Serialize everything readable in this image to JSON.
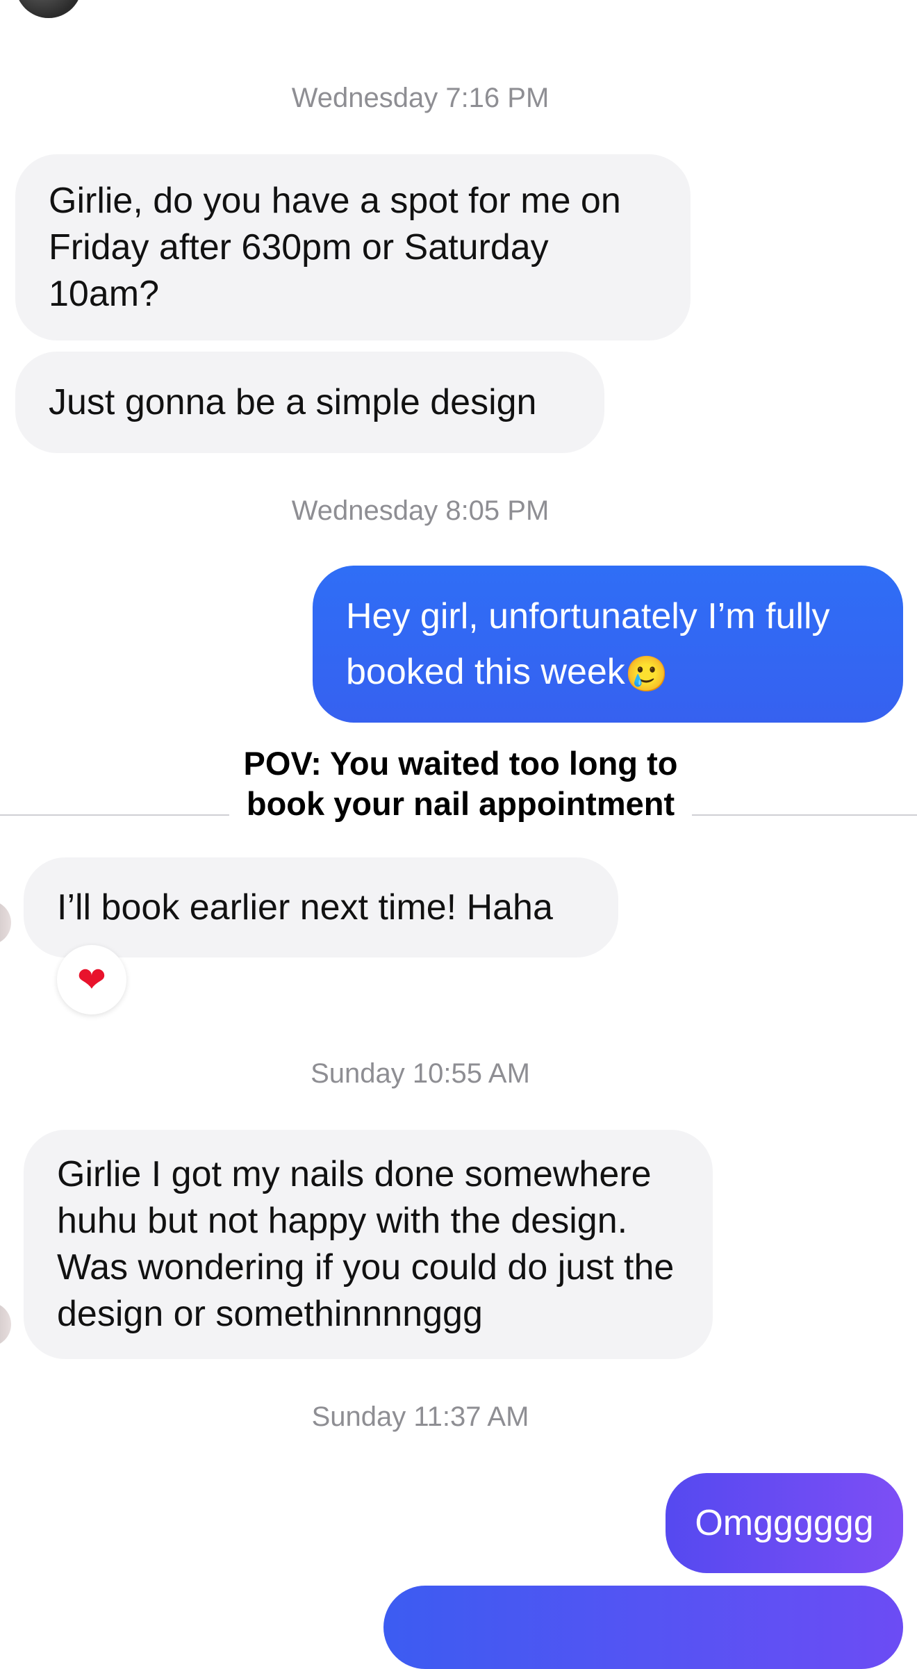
{
  "conversation": {
    "timestamps": {
      "t1": "Wednesday 7:16 PM",
      "t2": "Wednesday 8:05 PM",
      "t3": "Sunday 10:55 AM",
      "t4": "Sunday 11:37 AM"
    },
    "messages": {
      "m1": "Girlie, do you have a spot for me on Friday after 630pm or Saturday 10am?",
      "m2": "Just gonna be a simple design",
      "m3": "Hey girl, unfortunately I’m fully booked this week",
      "m3_emoji": "🥲",
      "m4": "I’ll book earlier next time! Haha",
      "m4_reaction": "❤",
      "m5": "Girlie I got my nails done somewhere huhu but not happy with the design. Was wondering if you could do just the design or somethinnnnggg",
      "m6": "Omgggggg"
    }
  },
  "overlay": {
    "caption_line1": "POV: You waited too long to",
    "caption_line2": "book your nail appointment"
  },
  "colors": {
    "incoming_bubble": "#f3f3f5",
    "outgoing_blue": "#2f6ef6",
    "outgoing_purple": "#6a4cf3",
    "timestamp_text": "#8e8e93"
  }
}
